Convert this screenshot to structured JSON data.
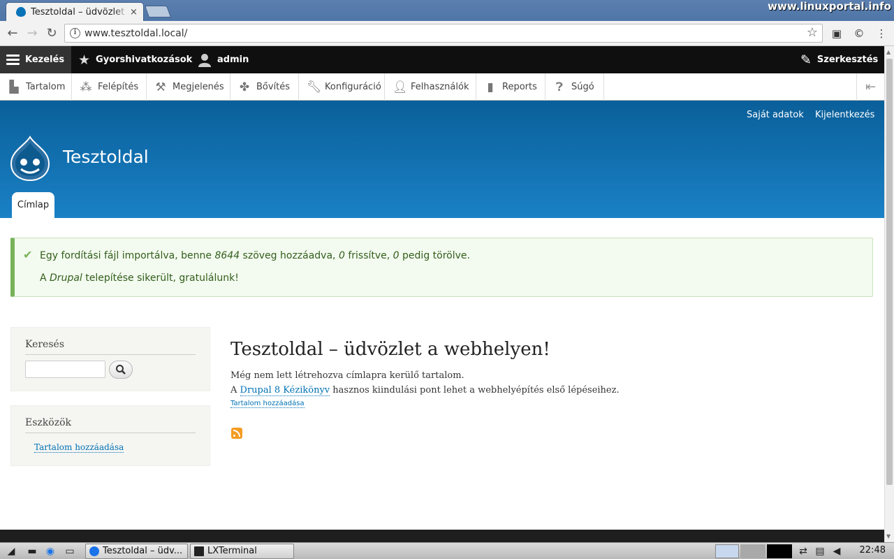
{
  "browser": {
    "tab_title": "Tesztoldal – üdvözlet a webhelyen!",
    "tab_close": "×",
    "url": "www.tesztoldal.local/",
    "watermark": "www.linuxportal.info"
  },
  "toolbar": {
    "manage": "Kezelés",
    "shortcuts": "Gyorshivatkozások",
    "user": "admin",
    "edit": "Szerkesztés"
  },
  "tray": {
    "items": [
      "Tartalom",
      "Felépítés",
      "Megjelenés",
      "Bővítés",
      "Konfiguráció",
      "Felhasználók",
      "Reports",
      "Súgó"
    ]
  },
  "header": {
    "account": "Saját adatok",
    "logout": "Kijelentkezés",
    "site_name": "Tesztoldal",
    "tab": "Címlap"
  },
  "message": {
    "line1_a": "Egy fordítási fájl importálva, benne ",
    "line1_n1": "8644",
    "line1_b": " szöveg hozzáadva, ",
    "line1_n2": "0",
    "line1_c": " frissítve, ",
    "line1_n3": "0",
    "line1_d": " pedig törölve.",
    "line2_a": "A ",
    "line2_i": "Drupal",
    "line2_b": " telepítése sikerült, gratulálunk!"
  },
  "sidebar": {
    "search_title": "Keresés",
    "tools_title": "Eszközök",
    "tools_link": "Tartalom hozzáadása"
  },
  "main": {
    "title": "Tesztoldal – üdvözlet a webhelyen!",
    "p1": "Még nem lett létrehozva címlapra kerülő tartalom.",
    "p2_a": "A ",
    "p2_link": "Drupal 8 Kézikönyv",
    "p2_b": " hasznos kiindulási pont lehet a webhelyépítés első lépéseihez.",
    "add_link": "Tartalom hozzáadása"
  },
  "taskbar": {
    "win1": "Tesztoldal – üdv...",
    "win2": "LXTerminal",
    "clock": "22:48"
  },
  "colors": {
    "header_top": "#0a5f99",
    "header_bottom": "#1a81c6",
    "link": "#0071b3",
    "status_green": "#77b259"
  }
}
